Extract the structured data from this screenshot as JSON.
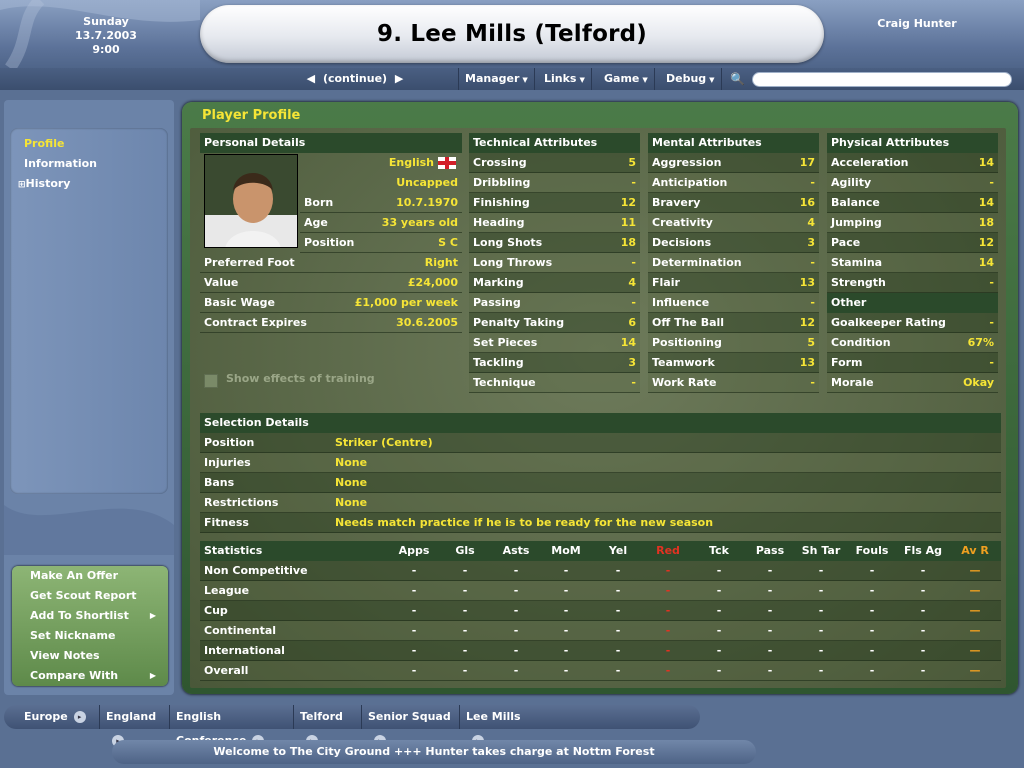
{
  "header": {
    "date": {
      "day": "Sunday",
      "date": "13.7.2003",
      "time": "9:00"
    },
    "title": "9. Lee Mills (Telford)",
    "user": "Craig Hunter"
  },
  "menubar": {
    "continue": "(continue)",
    "items": [
      "Manager",
      "Links",
      "Game",
      "Debug"
    ],
    "search_placeholder": ""
  },
  "sidebar": {
    "nav": [
      "Profile",
      "Information",
      "History"
    ],
    "actions": [
      "Make An Offer",
      "Get Scout Report",
      "Add To Shortlist",
      "Set Nickname",
      "View Notes",
      "Compare With"
    ]
  },
  "page_title": "Player Profile",
  "personal": {
    "header": "Personal Details",
    "nationality": "English",
    "international": "Uncapped",
    "born_label": "Born",
    "born": "10.7.1970",
    "age_label": "Age",
    "age": "33 years old",
    "position_label": "Position",
    "position": "S C",
    "foot_label": "Preferred Foot",
    "foot": "Right",
    "value_label": "Value",
    "value": "£24,000",
    "wage_label": "Basic Wage",
    "wage": "£1,000 per week",
    "contract_label": "Contract Expires",
    "contract": "30.6.2005",
    "training_label": "Show effects of training"
  },
  "technical": {
    "header": "Technical Attributes",
    "rows": [
      {
        "label": "Crossing",
        "value": "5"
      },
      {
        "label": "Dribbling",
        "value": "-"
      },
      {
        "label": "Finishing",
        "value": "12"
      },
      {
        "label": "Heading",
        "value": "11"
      },
      {
        "label": "Long Shots",
        "value": "18"
      },
      {
        "label": "Long Throws",
        "value": "-"
      },
      {
        "label": "Marking",
        "value": "4"
      },
      {
        "label": "Passing",
        "value": "-"
      },
      {
        "label": "Penalty Taking",
        "value": "6"
      },
      {
        "label": "Set Pieces",
        "value": "14"
      },
      {
        "label": "Tackling",
        "value": "3"
      },
      {
        "label": "Technique",
        "value": "-"
      }
    ]
  },
  "mental": {
    "header": "Mental Attributes",
    "rows": [
      {
        "label": "Aggression",
        "value": "17"
      },
      {
        "label": "Anticipation",
        "value": "-"
      },
      {
        "label": "Bravery",
        "value": "16"
      },
      {
        "label": "Creativity",
        "value": "4"
      },
      {
        "label": "Decisions",
        "value": "3"
      },
      {
        "label": "Determination",
        "value": "-"
      },
      {
        "label": "Flair",
        "value": "13"
      },
      {
        "label": "Influence",
        "value": "-"
      },
      {
        "label": "Off The Ball",
        "value": "12"
      },
      {
        "label": "Positioning",
        "value": "5"
      },
      {
        "label": "Teamwork",
        "value": "13"
      },
      {
        "label": "Work Rate",
        "value": "-"
      }
    ]
  },
  "physical": {
    "header": "Physical Attributes",
    "rows": [
      {
        "label": "Acceleration",
        "value": "14"
      },
      {
        "label": "Agility",
        "value": "-"
      },
      {
        "label": "Balance",
        "value": "14"
      },
      {
        "label": "Jumping",
        "value": "18"
      },
      {
        "label": "Pace",
        "value": "12"
      },
      {
        "label": "Stamina",
        "value": "14"
      },
      {
        "label": "Strength",
        "value": "-"
      }
    ],
    "other_header": "Other",
    "other_rows": [
      {
        "label": "Goalkeeper Rating",
        "value": "-"
      },
      {
        "label": "Condition",
        "value": "67%"
      },
      {
        "label": "Form",
        "value": "-"
      },
      {
        "label": "Morale",
        "value": "Okay"
      }
    ]
  },
  "selection": {
    "header": "Selection Details",
    "rows": [
      {
        "label": "Position",
        "value": "Striker (Centre)"
      },
      {
        "label": "Injuries",
        "value": "None"
      },
      {
        "label": "Bans",
        "value": "None"
      },
      {
        "label": "Restrictions",
        "value": "None"
      },
      {
        "label": "Fitness",
        "value": "Needs match practice if he is to be ready for the new season"
      }
    ]
  },
  "statistics": {
    "header": "Statistics",
    "columns": [
      "Apps",
      "Gls",
      "Asts",
      "MoM",
      "Yel",
      "Red",
      "Tck",
      "Pass",
      "Sh Tar",
      "Fouls",
      "Fls Ag",
      "Av R"
    ],
    "rows": [
      {
        "label": "Non Competitive"
      },
      {
        "label": "League"
      },
      {
        "label": "Cup"
      },
      {
        "label": "Continental"
      },
      {
        "label": "International"
      },
      {
        "label": "Overall"
      }
    ],
    "cell": "-",
    "rating_cell": "—",
    "colors": {
      "red": "#e23222",
      "rating": "#f0a020"
    }
  },
  "breadcrumbs": [
    "Europe",
    "England",
    "English Conference",
    "Telford",
    "Senior Squad",
    "Lee Mills"
  ],
  "news": "Welcome to The City Ground   +++   Hunter takes charge at Nottm Forest"
}
